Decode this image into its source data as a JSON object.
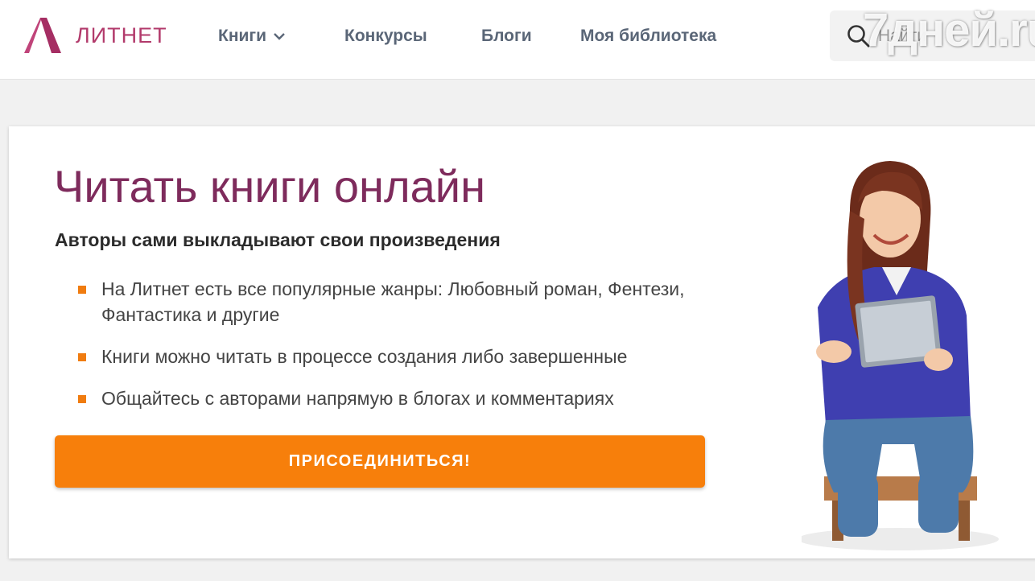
{
  "header": {
    "logo_text": "ЛИТНЕТ",
    "nav": [
      {
        "label": "Книги",
        "has_dropdown": true
      },
      {
        "label": "Конкурсы"
      },
      {
        "label": "Блоги"
      },
      {
        "label": "Моя библиотека"
      }
    ],
    "search": {
      "placeholder": "Найти",
      "icon": "search-icon"
    }
  },
  "watermark": "7дней.ru",
  "hero": {
    "title": "Читать книги онлайн",
    "subtitle": "Авторы сами выкладывают свои произведения",
    "features": [
      "На Литнет есть все популярные жанры: Любовный роман, Фентези, Фантастика и другие",
      "Книги можно читать в процессе создания либо завершенные",
      "Общайтесь с авторами напрямую в блогах и комментариях"
    ],
    "cta_label": "ПРИСОЕДИНИТЬСЯ!"
  },
  "colors": {
    "brand": "#b23a6b",
    "title": "#7e2b5c",
    "accent": "#f77f0b",
    "nav_text": "#5a6677"
  }
}
